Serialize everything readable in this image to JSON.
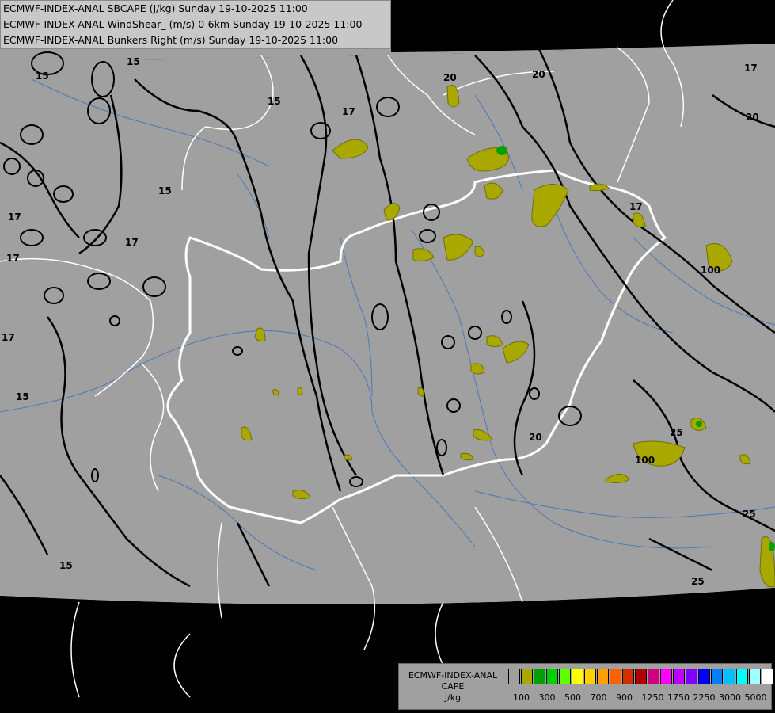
{
  "title_lines": [
    "ECMWF-INDEX-ANAL SBCAPE (J/kg) Sunday 19-10-2025 11:00",
    "ECMWF-INDEX-ANAL WindShear_ (m/s) 0-6km Sunday 19-10-2025 11:00",
    "ECMWF-INDEX-ANAL Bunkers Right (m/s) Sunday 19-10-2025 11:00"
  ],
  "legend": {
    "title_line1": "ECMWF-INDEX-ANAL",
    "title_line2": "CAPE",
    "title_line3": "J/kg",
    "colors": [
      "#a0a0a0",
      "#a8a800",
      "#00a000",
      "#00d000",
      "#60ff00",
      "#ffff00",
      "#ffd000",
      "#ffa000",
      "#ff6000",
      "#d03000",
      "#b00000",
      "#d00080",
      "#ff00ff",
      "#c000ff",
      "#8000ff",
      "#0000ff",
      "#0080ff",
      "#00c0ff",
      "#00ffff",
      "#a0ffff",
      "#ffffff"
    ],
    "tick_labels": [
      "100",
      "300",
      "500",
      "700",
      "900",
      "1250",
      "1750",
      "2250",
      "3000",
      "5000"
    ]
  },
  "contour_labels": [
    "15",
    "15",
    "15",
    "15",
    "15",
    "15",
    "17",
    "17",
    "17",
    "17",
    "17",
    "17",
    "17",
    "17",
    "20",
    "20",
    "20",
    "20",
    "25",
    "25",
    "25",
    "100",
    "100"
  ],
  "colors": {
    "map_background": "#a0a0a0",
    "outside_domain": "#000000",
    "borders": "#ffffff",
    "rivers": "#4a78b8",
    "cape_100": "#a8a800",
    "cape_300": "#00a000"
  }
}
